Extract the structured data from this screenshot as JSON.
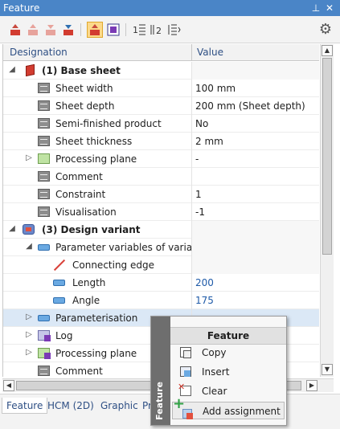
{
  "window": {
    "title": "Feature",
    "pin_glyph": "⊥",
    "close_glyph": "✕"
  },
  "toolbar": {
    "buttons": [
      {
        "name": "feature-up-icon",
        "active": false
      },
      {
        "name": "feature-up-grey-icon",
        "active": false
      },
      {
        "name": "feature-down-grey-icon",
        "active": false
      },
      {
        "name": "feature-down-icon",
        "active": false
      },
      {
        "name": "feature-recalc-icon",
        "active": true
      },
      {
        "name": "feature-jump-icon",
        "active": false
      },
      {
        "name": "tree-level-1-icon",
        "active": false
      },
      {
        "name": "tree-level-2-icon",
        "active": false
      },
      {
        "name": "tree-level-n-icon",
        "active": false
      }
    ],
    "gear_glyph": "⚙"
  },
  "grid": {
    "columns": [
      "Designation",
      "Value"
    ],
    "rows": [
      {
        "label": "(1) Base sheet",
        "value": "",
        "bold": true,
        "expander": "◢"
      },
      {
        "label": "Sheet width",
        "value": "100 mm"
      },
      {
        "label": "Sheet depth",
        "value": "200 mm  (Sheet depth)"
      },
      {
        "label": "Semi-finished product",
        "value": "No"
      },
      {
        "label": "Sheet thickness",
        "value": "2 mm"
      },
      {
        "label": "Processing plane",
        "value": "-",
        "expander": "▷"
      },
      {
        "label": "Comment",
        "value": ""
      },
      {
        "label": "Constraint",
        "value": "1"
      },
      {
        "label": "Visualisation",
        "value": "-1"
      },
      {
        "label": "(3) Design variant",
        "value": "",
        "bold": true,
        "expander": "◢"
      },
      {
        "label": "Parameter variables of variant",
        "value": "",
        "expander": "◢"
      },
      {
        "label": "Connecting edge",
        "value": ""
      },
      {
        "label": "Length",
        "value": "200"
      },
      {
        "label": "Angle",
        "value": "175"
      },
      {
        "label": "Parameterisation",
        "value": "",
        "expander": "▷"
      },
      {
        "label": "Log",
        "value": "",
        "expander": "▷"
      },
      {
        "label": "Processing plane",
        "value": "",
        "expander": "▷"
      },
      {
        "label": "Comment",
        "value": ""
      }
    ]
  },
  "scrollbars": {
    "up": "▲",
    "down": "▼",
    "left": "◀",
    "right": "▶"
  },
  "tabs": [
    "Feature",
    "HCM (2D)",
    "Graphic",
    "Pr"
  ],
  "context_menu": {
    "side_label": "Feature",
    "header": "Feature",
    "items": [
      "Copy",
      "Insert",
      "Clear",
      "Add assignment"
    ],
    "plus_glyph": "+"
  },
  "colors": {
    "title_bar": "#4a85c7",
    "header_text": "#2e4f84",
    "value_blue": "#1e5aa8",
    "selection": "#dbe8f6",
    "active_tool": "#fcd98a"
  }
}
